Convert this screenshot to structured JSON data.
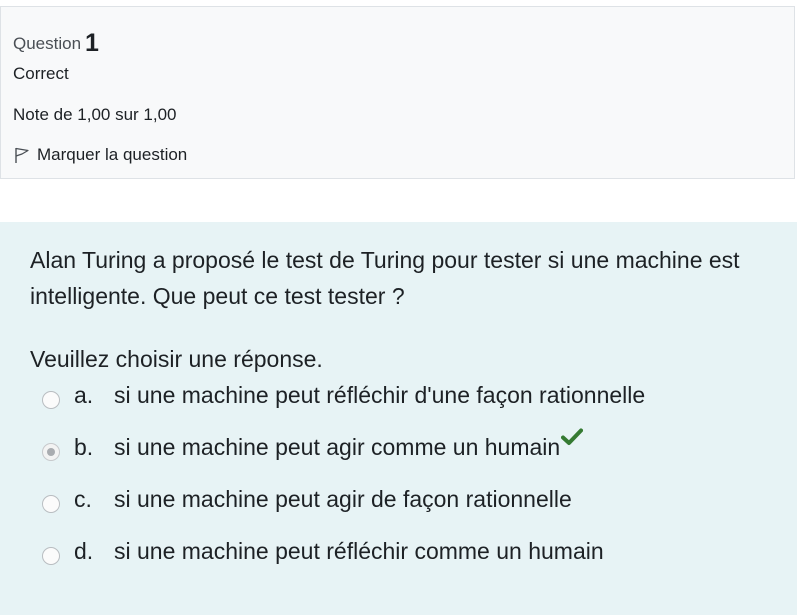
{
  "info": {
    "question_label": "Question",
    "question_number": "1",
    "state": "Correct",
    "grade": "Note de 1,00 sur 1,00",
    "flag_label": "Marquer la question"
  },
  "question": {
    "text": "Alan Turing a proposé le test de Turing pour tester si une machine est intelligente. Que peut ce test tester ?",
    "prompt": "Veuillez choisir une réponse.",
    "options": [
      {
        "letter": "a.",
        "text": "si une machine peut réfléchir d'une façon rationnelle",
        "selected": false,
        "correct": false
      },
      {
        "letter": "b.",
        "text": "si une machine peut agir comme un humain",
        "selected": true,
        "correct": true
      },
      {
        "letter": "c.",
        "text": "si une machine peut agir de façon rationnelle",
        "selected": false,
        "correct": false
      },
      {
        "letter": "d.",
        "text": "si une machine peut réfléchir comme un humain",
        "selected": false,
        "correct": false
      }
    ]
  },
  "colors": {
    "info_bg": "#f8f9fa",
    "formulation_bg": "#e7f3f5",
    "correct_tick": "#357a32"
  },
  "icons": {
    "flag": "flag-icon",
    "correct": "check-icon"
  }
}
